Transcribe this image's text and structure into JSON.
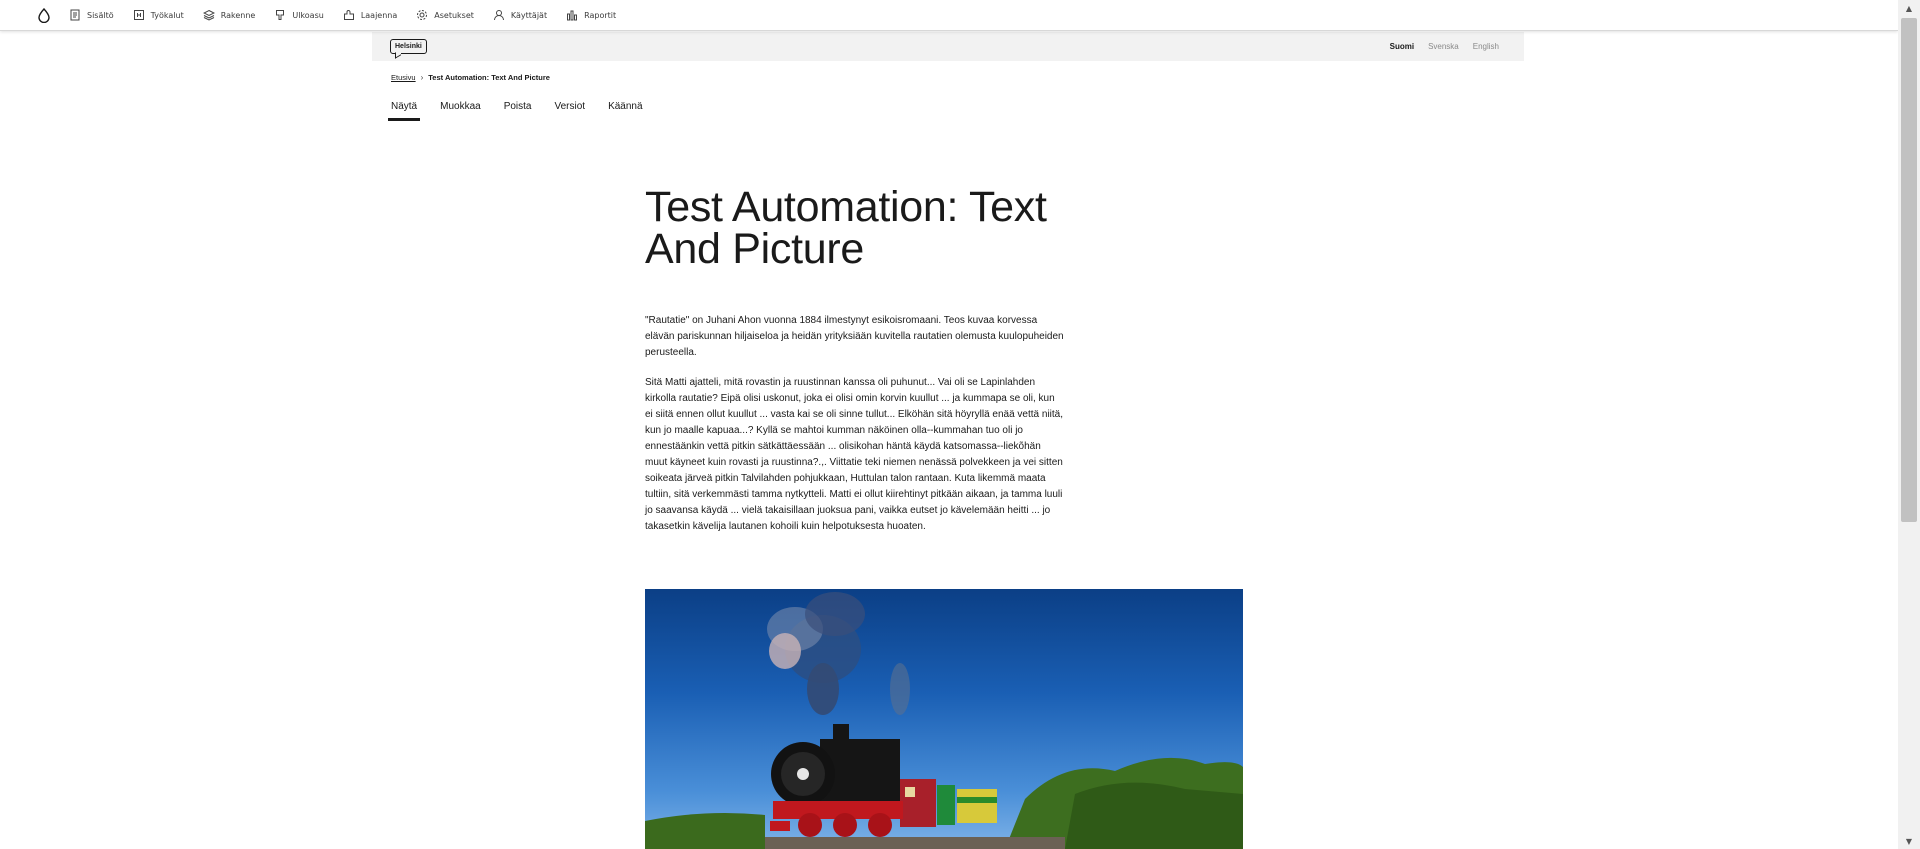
{
  "toolbar": {
    "items": [
      {
        "label": "Sisältö",
        "icon": "content-icon"
      },
      {
        "label": "Työkalut",
        "icon": "tools-icon"
      },
      {
        "label": "Rakenne",
        "icon": "structure-icon"
      },
      {
        "label": "Ulkoasu",
        "icon": "appearance-icon"
      },
      {
        "label": "Laajenna",
        "icon": "extend-icon"
      },
      {
        "label": "Asetukset",
        "icon": "gear-icon"
      },
      {
        "label": "Käyttäjät",
        "icon": "user-icon"
      },
      {
        "label": "Raportit",
        "icon": "reports-icon"
      }
    ]
  },
  "header": {
    "logo": "Helsinki",
    "languages": [
      {
        "label": "Suomi",
        "active": true
      },
      {
        "label": "Svenska",
        "active": false
      },
      {
        "label": "English",
        "active": false
      }
    ]
  },
  "breadcrumb": {
    "home": "Etusivu",
    "current": "Test Automation: Text And Picture"
  },
  "tabs": [
    {
      "label": "Näytä",
      "active": true
    },
    {
      "label": "Muokkaa",
      "active": false
    },
    {
      "label": "Poista",
      "active": false
    },
    {
      "label": "Versiot",
      "active": false
    },
    {
      "label": "Käännä",
      "active": false
    }
  ],
  "content": {
    "title": "Test Automation: Text And Picture",
    "paragraphs": [
      "\"Rautatie\" on Juhani Ahon vuonna 1884 ilmestynyt esikoisromaani. Teos kuvaa korvessa elävän pariskunnan hiljaiseloa ja heidän yrityksiään kuvitella rautatien olemusta kuulopuheiden perusteella.",
      "Sitä Matti ajatteli, mitä rovastin ja ruustinnan kanssa oli puhunut... Vai oli se Lapinlahden kirkolla rautatie? Eipä olisi uskonut, joka ei olisi omin korvin kuullut ... ja kummapa se oli, kun ei siitä ennen ollut kuullut ... vasta kai se oli sinne tullut... Elköhän sitä höyryllä enää vettä niitä, kun jo maalle kapuaa...? Kyllä se mahtoi kumman näköinen olla--kummahan tuo oli jo ennestäänkin vettä pitkin sätkättäessään ... olisikohan häntä käydä katsomassa--liekõhän muut käyneet kuin rovasti ja ruustinna?.,. Viittatie teki niemen nenässä polvekkeen ja vei sitten soikeata järveä pitkin Talvilahden pohjukkaan, Huttulan talon rantaan. Kuta likemmä maata tultiin, sitä verkemmästi tamma nytkytteli. Matti ei ollut kiirehtinyt pitkään aikaan, ja tamma luuli jo saavansa käydä ... vielä takaisillaan juoksua pani, vaikka eutset jo kävelemään heitti ... jo takasetkin kävelija lautanen kohoili kuin helpotuksesta huoaten."
    ],
    "image": "steam-locomotive-photo"
  },
  "colors": {
    "text": "#1a1a1a",
    "header_bg": "#f2f2f2",
    "muted": "#8a8a8a"
  }
}
